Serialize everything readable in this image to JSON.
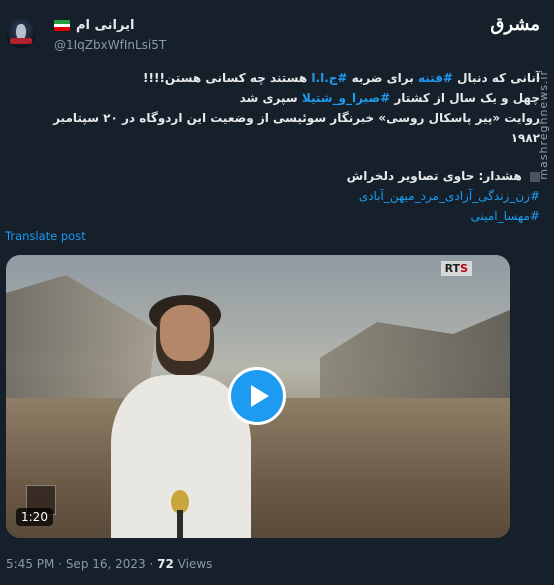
{
  "author": {
    "display_name": "ایرانی ام",
    "handle": "@1IqZbxWfInLsi5T",
    "flag_colors": [
      "#239f40",
      "#ffffff",
      "#da0000"
    ]
  },
  "brand": {
    "logo_text": "مشرق",
    "watermark": "mashreghnews.ir"
  },
  "tweet": {
    "line1_a": "آنانی که دنبال",
    "line1_link1": "#فتنه",
    "line1_b": "برای ضربه",
    "line1_link2": "#ج.ا.ا",
    "line1_c": "هستند چه کسانی هستن!!!!",
    "line2_a": "چهل و یک سال از کشتار",
    "line2_link": "#صبرا_و_شتیلا",
    "line2_b": "سپری شد",
    "line3": "روایت «پیر پاسکال روسی» خبرنگار سوئیسی از وضعیت این اردوگاه در ۲۰ سپتامبر ۱۹۸۲",
    "warning": "هشدار: حاوی تصاویر دلخراش",
    "hashtag1": "#زن_زندگی_آزادی_مرد_میهن_آبادی",
    "hashtag2": "#مهسا_امینی"
  },
  "translate_label": "Translate post",
  "video": {
    "channel_badge_main": "RT",
    "channel_badge_accent": "S",
    "duration": "1:20",
    "play_label": "Play video"
  },
  "meta": {
    "time": "5:45 PM",
    "separator": " · ",
    "date": "Sep 16, 2023",
    "views_count": "72",
    "views_label": " Views"
  }
}
